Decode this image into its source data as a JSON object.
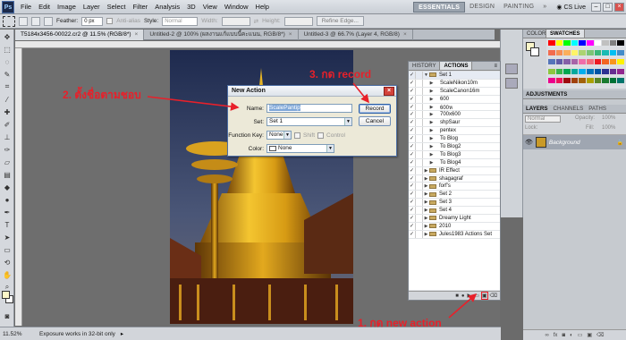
{
  "app": {
    "logo": "Ps"
  },
  "menu": [
    "File",
    "Edit",
    "Image",
    "Layer",
    "Select",
    "Filter",
    "Analysis",
    "3D",
    "View",
    "Window",
    "Help"
  ],
  "workspaces": {
    "essentials": "ESSENTIALS",
    "design": "DESIGN",
    "painting": "PAINTING",
    "more": "»",
    "cslive": "CS Live"
  },
  "options": {
    "feather_label": "Feather:",
    "feather_value": "0 px",
    "antialias": "Anti-alias",
    "style_label": "Style:",
    "style_value": "Normal",
    "width_label": "Width:",
    "height_label": "Height:",
    "refine": "Refine Edge..."
  },
  "tabs": [
    {
      "label": "T5184x3456-00022.cr2 @ 11.5% (RGB/8*)"
    },
    {
      "label": "Untitled-2 @ 100% (ผลงานแก้แบบนี้คะแนน, RGB/8*)"
    },
    {
      "label": "Untitled-3 @ 66.7% (Layer 4, RGB/8)"
    }
  ],
  "status": {
    "zoom": "11.52%",
    "message": "Exposure works in 32-bit only"
  },
  "dialog": {
    "title": "New Action",
    "name_label": "Name:",
    "name_value": "ScalePantip",
    "set_label": "Set:",
    "set_value": "Set 1",
    "fkey_label": "Function Key:",
    "fkey_value": "None",
    "shift": "Shift",
    "control": "Control",
    "color_label": "Color:",
    "color_value": "None",
    "record": "Record",
    "cancel": "Cancel"
  },
  "actions_panel": {
    "tabs": [
      "HISTORY",
      "ACTIONS"
    ],
    "items": [
      {
        "label": "Set 1",
        "type": "set",
        "open": true
      },
      {
        "label": "ScaleNikon10m",
        "type": "action"
      },
      {
        "label": "ScaleCanon16m",
        "type": "action"
      },
      {
        "label": "600",
        "type": "action"
      },
      {
        "label": "600ห",
        "type": "action"
      },
      {
        "label": "700x600",
        "type": "action"
      },
      {
        "label": "shpSaur",
        "type": "action"
      },
      {
        "label": "pentex",
        "type": "action"
      },
      {
        "label": "To Blog",
        "type": "action"
      },
      {
        "label": "To Blog2",
        "type": "action"
      },
      {
        "label": "To Blog3",
        "type": "action"
      },
      {
        "label": "To Blog4",
        "type": "action"
      },
      {
        "label": "IR Effect",
        "type": "set"
      },
      {
        "label": "shagagraf",
        "type": "set"
      },
      {
        "label": "forf's",
        "type": "set"
      },
      {
        "label": "Set 2",
        "type": "set"
      },
      {
        "label": "Set 3",
        "type": "set"
      },
      {
        "label": "Set 4",
        "type": "set"
      },
      {
        "label": "Dreamy Light",
        "type": "set"
      },
      {
        "label": "2010",
        "type": "set"
      },
      {
        "label": "Jules1983 Actions Set",
        "type": "set"
      }
    ]
  },
  "right": {
    "color_tab": "COLOR",
    "swatches_tab": "SWATCHES",
    "adjustments_tab": "ADJUSTMENTS",
    "layers_tabs": [
      "LAYERS",
      "CHANNELS",
      "PATHS"
    ],
    "blend": "Normal",
    "opacity_label": "Opacity:",
    "opacity": "100%",
    "lock_label": "Lock:",
    "fill_label": "Fill:",
    "fill": "100%",
    "layer_name": "Background"
  },
  "annotations": {
    "step1": "1. กด new action",
    "step2": "2. ตั้งชื่อตามชอบ",
    "step3": "3. กด record",
    "color": "#e8202a"
  }
}
